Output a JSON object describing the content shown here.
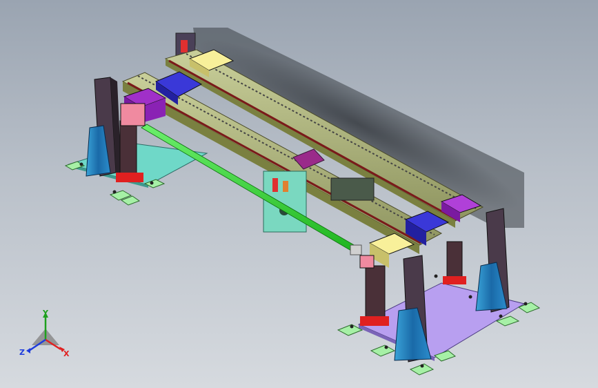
{
  "app": {
    "title": ""
  },
  "viewport": {
    "background": [
      "#9aa4b1",
      "#d6dadf"
    ]
  },
  "model": {
    "name": ""
  },
  "triad": {
    "x_label": "X",
    "y_label": "Y",
    "z_label": "Z",
    "colors": {
      "x": "#e02020",
      "y": "#1ea01e",
      "z": "#1e3cdc"
    }
  }
}
